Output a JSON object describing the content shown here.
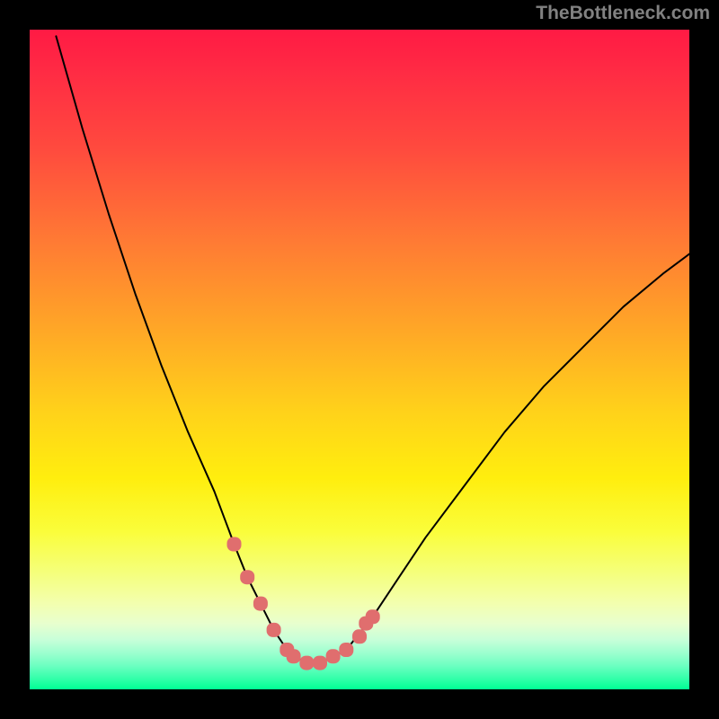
{
  "watermark": "TheBottleneck.com",
  "colors": {
    "frame": "#000000",
    "curve_stroke": "#000000",
    "marker_fill": "#e06e6e"
  },
  "chart_data": {
    "type": "line",
    "title": "",
    "xlabel": "",
    "ylabel": "",
    "xlim": [
      0,
      100
    ],
    "ylim": [
      0,
      100
    ],
    "grid": false,
    "legend": false,
    "series": [
      {
        "name": "bottleneck-curve",
        "x": [
          4,
          8,
          12,
          16,
          20,
          24,
          28,
          31,
          33,
          35,
          37,
          39,
          40,
          42,
          44,
          46,
          48,
          52,
          56,
          60,
          66,
          72,
          78,
          84,
          90,
          96,
          100
        ],
        "values": [
          99,
          85,
          72,
          60,
          49,
          39,
          30,
          22,
          17,
          13,
          9,
          6,
          5,
          4,
          4,
          5,
          6,
          11,
          17,
          23,
          31,
          39,
          46,
          52,
          58,
          63,
          66
        ]
      }
    ],
    "markers": [
      {
        "name": "highlight-dots",
        "shape": "rounded-square",
        "color": "#e06e6e",
        "points": [
          {
            "x": 31,
            "y": 22
          },
          {
            "x": 33,
            "y": 17
          },
          {
            "x": 35,
            "y": 13
          },
          {
            "x": 37,
            "y": 9
          },
          {
            "x": 39,
            "y": 6
          },
          {
            "x": 40,
            "y": 5
          },
          {
            "x": 42,
            "y": 4
          },
          {
            "x": 44,
            "y": 4
          },
          {
            "x": 46,
            "y": 5
          },
          {
            "x": 48,
            "y": 6
          },
          {
            "x": 50,
            "y": 8
          },
          {
            "x": 51,
            "y": 10
          },
          {
            "x": 52,
            "y": 11
          }
        ]
      }
    ]
  }
}
